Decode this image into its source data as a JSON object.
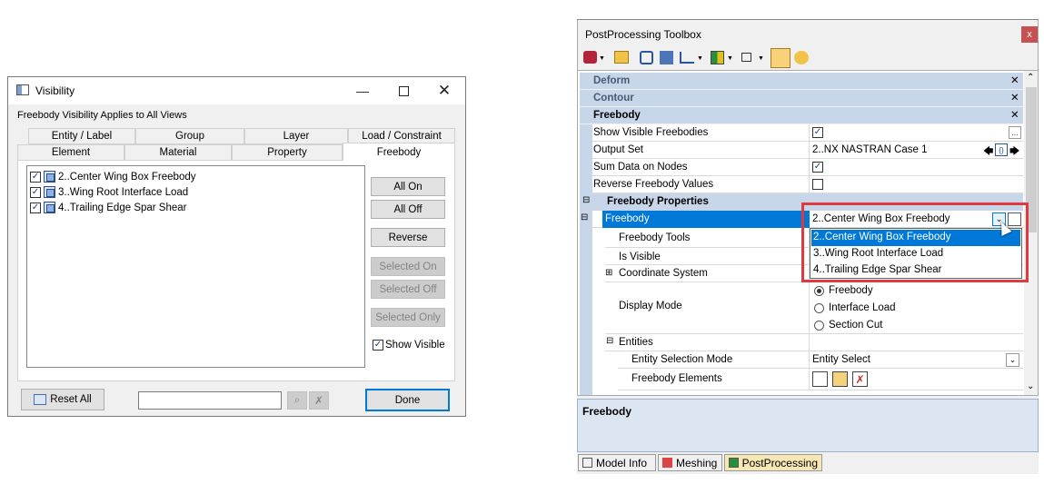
{
  "visibility": {
    "title": "Visibility",
    "header_text": "Freebody Visibility Applies to All Views",
    "tabs_row1": [
      "Entity / Label",
      "Group",
      "Layer",
      "Load / Constraint"
    ],
    "tabs_row2": [
      "Element",
      "Material",
      "Property",
      "Freebody"
    ],
    "list_items": [
      {
        "label": "2..Center Wing Box Freebody",
        "checked": true
      },
      {
        "label": "3..Wing Root Interface Load",
        "checked": true
      },
      {
        "label": "4..Trailing Edge Spar Shear",
        "checked": true
      }
    ],
    "buttons": {
      "all_on": "All On",
      "all_off": "All Off",
      "reverse": "Reverse",
      "selected_on": "Selected On",
      "selected_off": "Selected Off",
      "selected_only": "Selected Only"
    },
    "show_visible": {
      "label": "Show Visible",
      "checked": true
    },
    "reset_all": "Reset All",
    "filter_value": "",
    "done": "Done"
  },
  "toolbox": {
    "title": "PostProcessing Toolbox",
    "groups": {
      "deform": "Deform",
      "contour": "Contour",
      "freebody": "Freebody"
    },
    "rows": {
      "show_visible": "Show Visible Freebodies",
      "output_set": "Output Set",
      "output_set_value": "2..NX NASTRAN Case 1",
      "sum_data": "Sum Data on Nodes",
      "reverse_values": "Reverse Freebody Values",
      "freebody_properties": "Freebody Properties",
      "freebody": "Freebody",
      "freebody_value": "2..Center Wing Box Freebody",
      "freebody_tools": "Freebody Tools",
      "is_visible": "Is Visible",
      "coordinate_system": "Coordinate System",
      "display_mode": "Display Mode",
      "display_mode_options": [
        "Freebody",
        "Interface Load",
        "Section Cut"
      ],
      "entities": "Entities",
      "entity_selection_mode": "Entity Selection Mode",
      "entity_selection_value": "Entity Select",
      "freebody_elements": "Freebody Elements"
    },
    "dropdown_options": [
      "2..Center Wing Box Freebody",
      "3..Wing Root Interface Load",
      "4..Trailing Edge Spar Shear"
    ],
    "description_title": "Freebody",
    "bottom_tabs": [
      "Model Info",
      "Meshing",
      "PostProcessing"
    ],
    "colors": {
      "highlight": "#0078d7",
      "group_bg": "#c8d6ea",
      "red_box": "#e0393e"
    }
  }
}
